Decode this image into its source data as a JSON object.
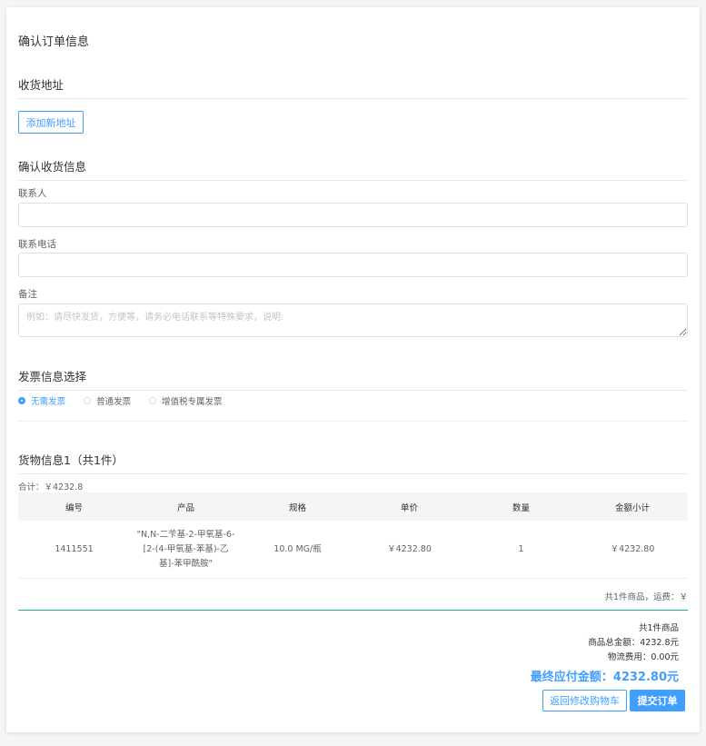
{
  "page_title": "确认订单信息",
  "address": {
    "section_title": "收货地址",
    "add_button": "添加新地址"
  },
  "receiver": {
    "section_title": "确认收货信息",
    "contact_label": "联系人",
    "contact_value": "",
    "phone_label": "联系电话",
    "phone_value": "",
    "remark_label": "备注",
    "remark_placeholder": "例如：请尽快发货，方便等，请务必电话联系等特殊要求，说明:"
  },
  "invoice": {
    "section_title": "发票信息选择",
    "options": [
      "无需发票",
      "普通发票",
      "增值税专属发票"
    ],
    "selected": "无需发票"
  },
  "goods": {
    "section_title": "货物信息1（共1件）",
    "total_text": "合计：￥4232.8",
    "columns": [
      "编号",
      "产品",
      "规格",
      "单价",
      "数量",
      "金额小计"
    ],
    "rows": [
      {
        "id": "1411551",
        "product": "\"N,N-二苄基-2-甲氧基-6-[2-(4-甲氧基-苯基)-乙基]-苯甲酰胺\"",
        "spec": "10.0 MG/瓶",
        "unit_price": "￥4232.80",
        "qty": "1",
        "subtotal": "￥4232.80"
      }
    ],
    "shipping_line": "共1件商品，运费：￥"
  },
  "summary": {
    "count": "共1件商品",
    "goods_total": "商品总金额：4232.8元",
    "logistics": "物流费用：0.00元",
    "final": "最终应付金额：4232.80元",
    "back_button": "返回修改购物车",
    "submit_button": "提交订单"
  },
  "colors": {
    "accent": "#409eff",
    "divider_accent": "#26a69a"
  }
}
